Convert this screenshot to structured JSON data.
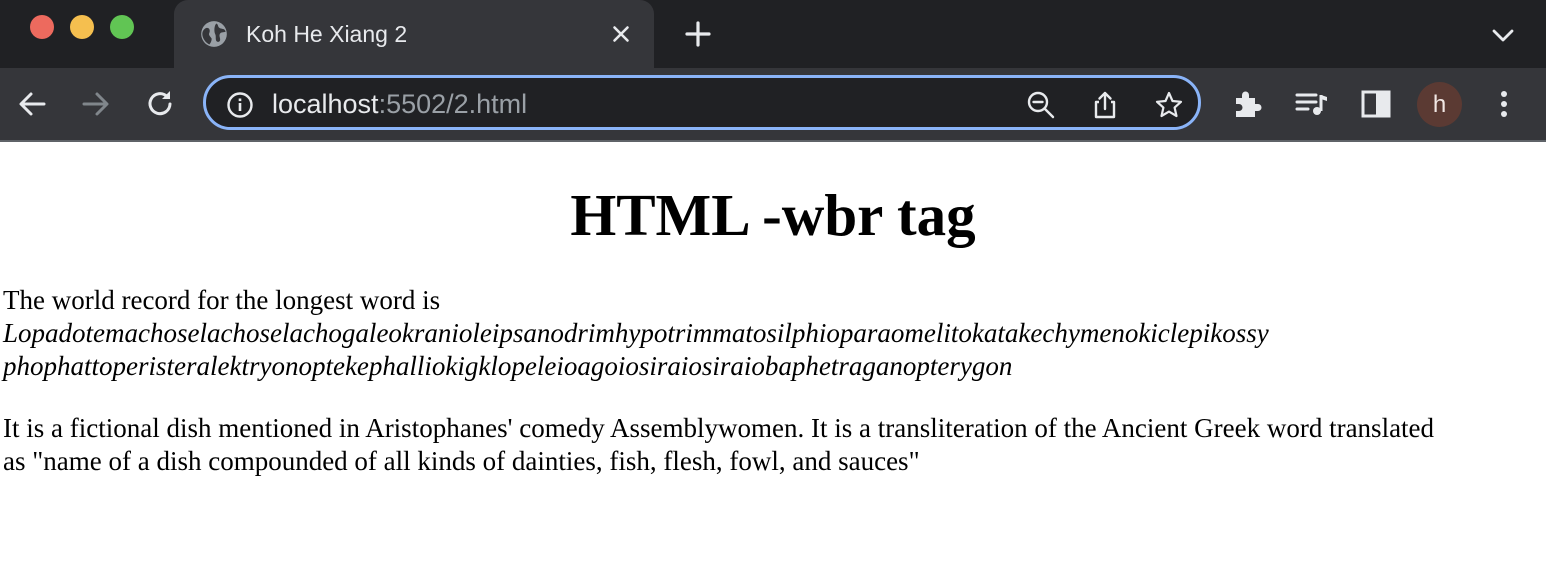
{
  "browser": {
    "tab": {
      "title": "Koh He Xiang 2",
      "favicon": "globe-icon"
    },
    "omnibox": {
      "host": "localhost",
      "path": ":5502/2.html"
    },
    "avatar_initial": "h",
    "colors": {
      "chrome_dark": "#202124",
      "chrome_toolbar": "#35363a",
      "omnibox_focus": "#8ab4f8",
      "avatar_bg": "#5b3a33"
    },
    "icons": [
      "back-icon",
      "forward-icon",
      "reload-icon",
      "info-icon",
      "zoom-out-icon",
      "share-icon",
      "star-icon",
      "extensions-icon",
      "media-icon",
      "side-panel-icon",
      "menu-icon",
      "tab-search-icon",
      "new-tab-icon",
      "close-icon"
    ]
  },
  "page": {
    "heading": "HTML -wbr tag",
    "intro_text": "The world record for the longest word is",
    "long_word_line1": "Lopadotemachoselachoselachogaleokranioleipsanodrimhypotrimmatosilphioparaomelitokatakechymenokiclepikossy",
    "long_word_line2": "phophattoperisteralektryonoptekephalliokigklopeleioagoiosiraiosiraiobaphetraganopterygon",
    "description_line1": "It is a fictional dish mentioned in Aristophanes' comedy Assemblywomen. It is a transliteration of the Ancient Greek word translated",
    "description_line2": "as \"name of a dish compounded of all kinds of dainties, fish, flesh, fowl, and sauces\""
  }
}
